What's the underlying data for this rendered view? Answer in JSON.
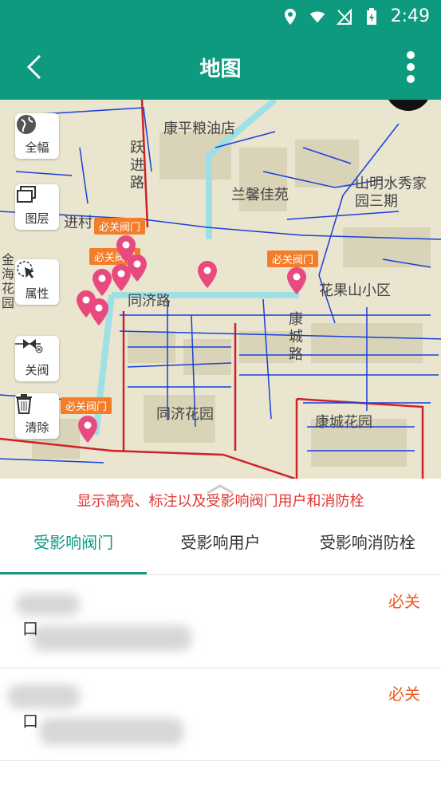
{
  "status_bar": {
    "time": "2:49"
  },
  "app_bar": {
    "title": "地图"
  },
  "map_tools": [
    {
      "label": "全幅",
      "icon": "globe-icon"
    },
    {
      "label": "图层",
      "icon": "layers-icon"
    },
    {
      "label": "属性",
      "icon": "pointer-icon"
    },
    {
      "label": "关阀",
      "icon": "valve-icon"
    },
    {
      "label": "清除",
      "icon": "trash-icon"
    }
  ],
  "map_labels": {
    "road_1": "康平粮油店",
    "road_2": "兰馨佳苑",
    "road_3": "山明水秀家园三期",
    "road_4": "花果山小区",
    "road_5": "同济路",
    "road_6": "康城路",
    "road_7": "同济花园",
    "road_8": "康城花园",
    "road_9": "进村",
    "road_10": "跃进路",
    "road_11": "金海花园"
  },
  "markers": [
    {
      "label": "必关阀门"
    },
    {
      "label": "必关阀门"
    },
    {
      "label": "必关阀门"
    },
    {
      "label": "必关阀门"
    }
  ],
  "hint_text": "显示高亮、标注以及受影响阀门用户和消防栓",
  "tabs": [
    {
      "label": "受影响阀门",
      "active": true
    },
    {
      "label": "受影响用户",
      "active": false
    },
    {
      "label": "受影响消防栓",
      "active": false
    }
  ],
  "valves": [
    {
      "status": "必关",
      "name": "口"
    },
    {
      "status": "必关",
      "name": "口"
    }
  ],
  "colors": {
    "primary": "#0e9a7f",
    "accent": "#f05a1c",
    "marker": "#e84a7f"
  }
}
